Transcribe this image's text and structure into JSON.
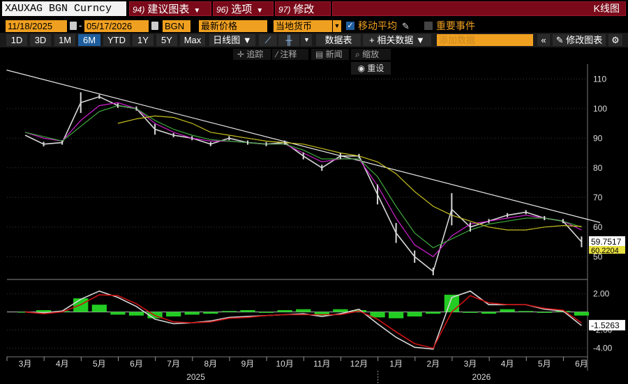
{
  "header": {
    "ticker": "XAUXAG BGN Curncy",
    "menu_build": {
      "num": "94)",
      "label": "建议图表"
    },
    "menu_options": {
      "num": "96)",
      "label": "选项"
    },
    "menu_edit": {
      "num": "97)",
      "label": "修改"
    },
    "chart_type_title": "K线图"
  },
  "date_range": {
    "start": "11/18/2025",
    "end": "05/17/2026",
    "source": "BGN",
    "price_field": "最新价格",
    "currency": "当地货币",
    "moving_average_label": "移动平均",
    "moving_average_checked": true,
    "events_label": "重要事件",
    "events_checked": false
  },
  "periods": {
    "items": [
      "1D",
      "3D",
      "1M",
      "6M",
      "YTD",
      "1Y",
      "5Y",
      "Max"
    ],
    "active": "6M",
    "frequency": "日线图",
    "datatable_label": "数据表",
    "related_label": "相关数据",
    "add_data_placeholder": "添加数据",
    "edit_chart_label": "修改图表"
  },
  "tools": {
    "track": "追踪",
    "annotate": "注释",
    "news": "新闻",
    "zoom": "缩放",
    "reset": "重设"
  },
  "colors": {
    "accent_orange": "#f0a020",
    "menu_red": "#7a0a1a",
    "active_blue": "#1f5e9e",
    "price": "#d8d8d8",
    "ma_short": "#d020d0",
    "ma_mid": "#3ea83e",
    "ma_long": "#c8c020",
    "trendline": "#e8e8e8",
    "histogram": "#22cc22",
    "macd_signal": "#cc1111"
  },
  "chart_data": [
    {
      "type": "line",
      "title": "",
      "price_axis": {
        "ticks": [
          50,
          60,
          70,
          80,
          90,
          100,
          110
        ],
        "ylim": [
          43,
          115
        ]
      },
      "x_ticks": [
        "3月",
        "4月",
        "5月",
        "6月",
        "7月",
        "8月",
        "9月",
        "10月",
        "11月",
        "12月",
        "1月",
        "2月",
        "3月",
        "4月",
        "5月",
        "6月"
      ],
      "year_labels": [
        "2025",
        "2026"
      ],
      "last_price_label": "59.7517",
      "ma_label": "60.2204",
      "x_months": [
        0,
        0.5,
        1,
        1.5,
        2,
        2.5,
        3,
        3.5,
        4,
        4.5,
        5,
        5.5,
        6,
        6.5,
        7,
        7.5,
        8,
        8.5,
        9,
        9.5,
        10,
        10.5,
        11,
        11.5,
        12,
        12.5,
        13,
        13.5,
        14,
        14.5,
        15
      ],
      "series": [
        {
          "values": [
            91,
            88,
            88.5,
            102,
            104,
            101,
            100,
            93,
            91,
            90,
            88,
            90,
            88.5,
            88,
            88.5,
            84,
            80,
            84,
            84,
            71,
            58,
            50,
            45,
            66,
            60,
            62,
            64,
            65,
            63,
            62,
            55
          ]
        },
        {
          "values": [
            92,
            90,
            89,
            96,
            101,
            102,
            100,
            95,
            92,
            90,
            89,
            89,
            88.5,
            88,
            88,
            85,
            82,
            83,
            83,
            74,
            63,
            54,
            50,
            57,
            61,
            62,
            63,
            64,
            63,
            62,
            59
          ]
        },
        {
          "values": [
            92,
            90.5,
            89,
            94,
            99,
            101,
            100,
            96,
            93,
            91,
            89.5,
            89,
            88.5,
            88,
            88,
            86,
            83,
            83,
            83,
            77,
            67,
            58,
            53,
            56,
            59,
            61,
            62,
            63,
            63,
            62,
            60
          ]
        },
        {
          "values": [
            null,
            null,
            null,
            null,
            null,
            95,
            96.5,
            97.5,
            97,
            95,
            92,
            91,
            90,
            89,
            88.5,
            88,
            86.5,
            85,
            84,
            82,
            78,
            72,
            67,
            64,
            62,
            60,
            59,
            59,
            60,
            60.5,
            60.2
          ]
        }
      ],
      "trendline": {
        "from": [
          -0.5,
          113
        ],
        "to": [
          15.5,
          61.5
        ]
      }
    },
    {
      "type": "bar",
      "title": "",
      "axis": {
        "ticks": [
          2.0,
          -2.0,
          -4.0
        ],
        "tick_labels": [
          "2.00",
          "-2.00",
          "-4.00"
        ],
        "ylim": [
          -4.8,
          3.2
        ]
      },
      "last_label": "-1.5263",
      "x_months": [
        0,
        0.5,
        1,
        1.5,
        2,
        2.5,
        3,
        3.5,
        4,
        4.5,
        5,
        5.5,
        6,
        6.5,
        7,
        7.5,
        8,
        8.5,
        9,
        9.5,
        10,
        10.5,
        11,
        11.5,
        12,
        12.5,
        13,
        13.5,
        14,
        14.5,
        15
      ],
      "series": [
        {
          "values": [
            0,
            0.2,
            0.1,
            1.5,
            0.8,
            -0.3,
            -0.4,
            -0.7,
            -0.5,
            -0.3,
            -0.2,
            0.1,
            0.2,
            -0.1,
            0.2,
            0.3,
            -0.4,
            0.3,
            0.2,
            -0.6,
            -0.7,
            -0.5,
            -0.2,
            1.9,
            -0.1,
            -0.2,
            0.3,
            0.1,
            -0.1,
            0.1,
            -0.4
          ]
        },
        {
          "values": [
            0,
            -0.1,
            0.1,
            1.4,
            2.3,
            1.6,
            0.6,
            -0.8,
            -1.3,
            -1.2,
            -1.0,
            -0.6,
            -0.5,
            -0.4,
            -0.3,
            -0.2,
            -0.5,
            -0.2,
            0.3,
            -1.3,
            -2.8,
            -3.9,
            -4.1,
            1.6,
            2.3,
            0.8,
            0.8,
            0.8,
            0.3,
            0.1,
            -1.5
          ]
        },
        {
          "values": [
            0,
            -0.2,
            0,
            0.8,
            1.9,
            1.8,
            0.9,
            -0.4,
            -1.1,
            -1.2,
            -1.1,
            -0.7,
            -0.6,
            -0.4,
            -0.3,
            -0.3,
            -0.3,
            -0.3,
            0.1,
            -0.8,
            -2.2,
            -3.5,
            -4.0,
            0,
            1.8,
            1.0,
            0.8,
            0.8,
            0.4,
            0.2,
            -1.2
          ]
        }
      ]
    }
  ]
}
